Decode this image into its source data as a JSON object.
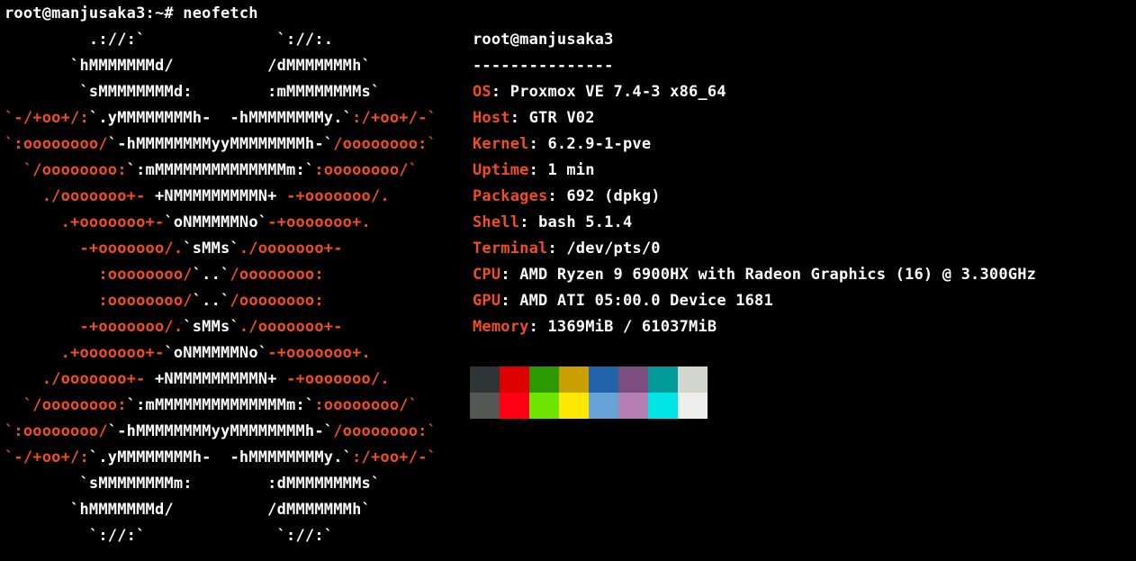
{
  "terminal": {
    "prompt_line": "root@manjusaka3:~# neofetch",
    "colors": {
      "background": "#000000",
      "foreground": "#ffffff",
      "accent_orange": "#ef4f1e"
    }
  },
  "ascii_logo": {
    "name": "proxmox-logo",
    "lines": [
      [
        {
          "c": "w",
          "t": "         .://:`              `://:."
        }
      ],
      [
        {
          "c": "w",
          "t": "       `hMMMMMMMd/          /dMMMMMMMh`"
        }
      ],
      [
        {
          "c": "w",
          "t": "        `sMMMMMMMMd:        :mMMMMMMMMs`"
        }
      ],
      [
        {
          "c": "o",
          "t": "`-/+oo+/:"
        },
        {
          "c": "w",
          "t": "`.yMMMMMMMMh-  -hMMMMMMMMy.`"
        },
        {
          "c": "o",
          "t": ":/+oo+/-`"
        }
      ],
      [
        {
          "c": "o",
          "t": "`:oooooooo/"
        },
        {
          "c": "w",
          "t": "`-hMMMMMMMMyyMMMMMMMMh-`"
        },
        {
          "c": "o",
          "t": "/oooooooo:`"
        }
      ],
      [
        {
          "c": "o",
          "t": "  `/oooooooo:"
        },
        {
          "c": "w",
          "t": "`:mMMMMMMMMMMMMMMm:`"
        },
        {
          "c": "o",
          "t": ":oooooooo/`"
        }
      ],
      [
        {
          "c": "o",
          "t": "    ./ooooooo+-"
        },
        {
          "c": "w",
          "t": " +NMMMMMMMMMN+ "
        },
        {
          "c": "o",
          "t": "-+ooooooo/."
        }
      ],
      [
        {
          "c": "o",
          "t": "      .+ooooooo+-"
        },
        {
          "c": "w",
          "t": "`oNMMMMMNo`"
        },
        {
          "c": "o",
          "t": "-+ooooooo+."
        }
      ],
      [
        {
          "c": "o",
          "t": "        -+ooooooo/."
        },
        {
          "c": "w",
          "t": "`sMMs`"
        },
        {
          "c": "o",
          "t": "./ooooooo+-"
        }
      ],
      [
        {
          "c": "o",
          "t": "          :oooooooo/"
        },
        {
          "c": "w",
          "t": "`..`"
        },
        {
          "c": "o",
          "t": "/oooooooo:"
        }
      ],
      [
        {
          "c": "o",
          "t": "          :oooooooo/"
        },
        {
          "c": "w",
          "t": "`..`"
        },
        {
          "c": "o",
          "t": "/oooooooo:"
        }
      ],
      [
        {
          "c": "o",
          "t": "        -+ooooooo/."
        },
        {
          "c": "w",
          "t": "`sMMs`"
        },
        {
          "c": "o",
          "t": "./ooooooo+-"
        }
      ],
      [
        {
          "c": "o",
          "t": "      .+ooooooo+-"
        },
        {
          "c": "w",
          "t": "`oNMMMMMNo`"
        },
        {
          "c": "o",
          "t": "-+ooooooo+."
        }
      ],
      [
        {
          "c": "o",
          "t": "    ./ooooooo+-"
        },
        {
          "c": "w",
          "t": " +NMMMMMMMMMN+ "
        },
        {
          "c": "o",
          "t": "-+ooooooo/."
        }
      ],
      [
        {
          "c": "o",
          "t": "  `/oooooooo:"
        },
        {
          "c": "w",
          "t": "`:mMMMMMMMMMMMMMMm:`"
        },
        {
          "c": "o",
          "t": ":oooooooo/`"
        }
      ],
      [
        {
          "c": "o",
          "t": "`:oooooooo/"
        },
        {
          "c": "w",
          "t": "`-hMMMMMMMMyyMMMMMMMMh-`"
        },
        {
          "c": "o",
          "t": "/oooooooo:`"
        }
      ],
      [
        {
          "c": "o",
          "t": "`-/+oo+/:"
        },
        {
          "c": "w",
          "t": "`.yMMMMMMMMh-  -hMMMMMMMMy.`"
        },
        {
          "c": "o",
          "t": ":/+oo+/-`"
        }
      ],
      [
        {
          "c": "w",
          "t": "        `sMMMMMMMMm:        :dMMMMMMMMs`"
        }
      ],
      [
        {
          "c": "w",
          "t": "       `hMMMMMMMd/          /dMMMMMMMh`"
        }
      ],
      [
        {
          "c": "w",
          "t": "         `://:`              `://:`"
        }
      ]
    ]
  },
  "info": {
    "title": "root@manjusaka3",
    "underline": "---------------",
    "separator": ": ",
    "entries": [
      {
        "label": "OS",
        "value": "Proxmox VE 7.4-3 x86_64"
      },
      {
        "label": "Host",
        "value": "GTR V02"
      },
      {
        "label": "Kernel",
        "value": "6.2.9-1-pve"
      },
      {
        "label": "Uptime",
        "value": "1 min"
      },
      {
        "label": "Packages",
        "value": "692 (dpkg)"
      },
      {
        "label": "Shell",
        "value": "bash 5.1.4"
      },
      {
        "label": "Terminal",
        "value": "/dev/pts/0"
      },
      {
        "label": "CPU",
        "value": "AMD Ryzen 9 6900HX with Radeon Graphics (16) @ 3.300GHz"
      },
      {
        "label": "GPU",
        "value": "AMD ATI 05:00.0 Device 1681"
      },
      {
        "label": "Memory",
        "value": "1369MiB / 61037MiB"
      }
    ],
    "palette_row1": [
      "#2d3537",
      "#dd0000",
      "#2b9a00",
      "#c9a000",
      "#2264aa",
      "#7d4f7e",
      "#029a9a",
      "#d3d6ce"
    ],
    "palette_row2": [
      "#555753",
      "#ff0013",
      "#6ce500",
      "#ffe704",
      "#67a3d9",
      "#b57fb1",
      "#00e5e5",
      "#eeeeec"
    ]
  }
}
